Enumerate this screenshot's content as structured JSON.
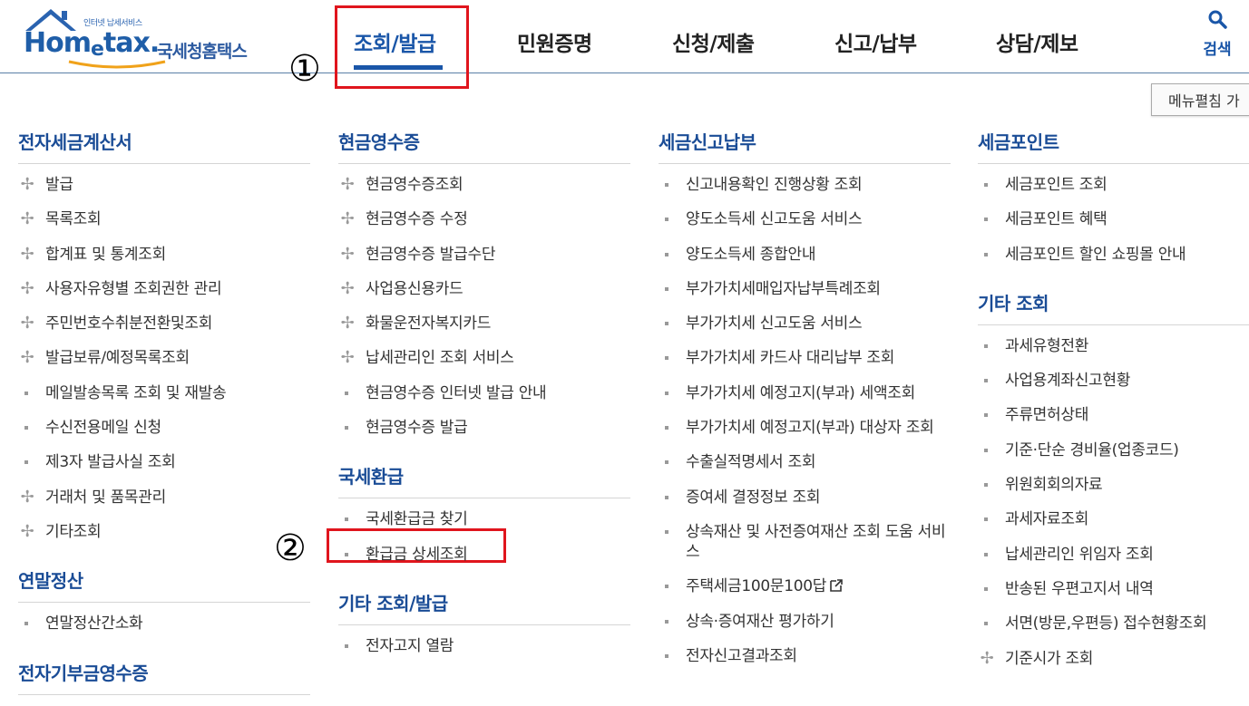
{
  "logo": {
    "tagline": "인터넷 납세서비스",
    "wordmark_1": "Hom",
    "wordmark_2": "e",
    "wordmark_3": "tax.",
    "korean": "국세청홈택스"
  },
  "gnb": [
    {
      "label": "조회/발급",
      "active": true
    },
    {
      "label": "민원증명"
    },
    {
      "label": "신청/제출"
    },
    {
      "label": "신고/납부"
    },
    {
      "label": "상담/제보"
    }
  ],
  "search": {
    "label": "검색",
    "icon": "search-icon"
  },
  "annotations": {
    "marker1": "①",
    "marker2": "②"
  },
  "toggle_button": "메뉴펼침 가",
  "columns": [
    {
      "sections": [
        {
          "title": "전자세금계산서",
          "items": [
            {
              "label": "발급",
              "icon": "plus"
            },
            {
              "label": "목록조회",
              "icon": "plus"
            },
            {
              "label": "합계표 및 통계조회",
              "icon": "plus"
            },
            {
              "label": "사용자유형별 조회권한 관리",
              "icon": "plus"
            },
            {
              "label": "주민번호수취분전환및조회",
              "icon": "plus"
            },
            {
              "label": "발급보류/예정목록조회",
              "icon": "plus"
            },
            {
              "label": "메일발송목록 조회 및 재발송",
              "icon": "bullet"
            },
            {
              "label": "수신전용메일 신청",
              "icon": "bullet"
            },
            {
              "label": "제3자 발급사실 조회",
              "icon": "bullet"
            },
            {
              "label": "거래처 및 품목관리",
              "icon": "plus"
            },
            {
              "label": "기타조회",
              "icon": "plus"
            }
          ]
        },
        {
          "title": "연말정산",
          "items": [
            {
              "label": "연말정산간소화",
              "icon": "bullet"
            }
          ]
        },
        {
          "title": "전자기부금영수증",
          "items": []
        }
      ]
    },
    {
      "sections": [
        {
          "title": "현금영수증",
          "items": [
            {
              "label": "현금영수증조회",
              "icon": "plus"
            },
            {
              "label": "현금영수증 수정",
              "icon": "plus"
            },
            {
              "label": "현금영수증 발급수단",
              "icon": "plus"
            },
            {
              "label": "사업용신용카드",
              "icon": "plus"
            },
            {
              "label": "화물운전자복지카드",
              "icon": "plus"
            },
            {
              "label": "납세관리인 조회 서비스",
              "icon": "plus"
            },
            {
              "label": "현금영수증 인터넷 발급 안내",
              "icon": "bullet"
            },
            {
              "label": "현금영수증 발급",
              "icon": "bullet"
            }
          ]
        },
        {
          "title": "국세환급",
          "items": [
            {
              "label": "국세환급금 찾기",
              "icon": "bullet"
            },
            {
              "label": "환급금 상세조회",
              "icon": "bullet"
            }
          ]
        },
        {
          "title": "기타 조회/발급",
          "items": [
            {
              "label": "전자고지 열람",
              "icon": "bullet"
            }
          ]
        }
      ]
    },
    {
      "sections": [
        {
          "title": "세금신고납부",
          "items": [
            {
              "label": "신고내용확인 진행상황 조회",
              "icon": "bullet"
            },
            {
              "label": "양도소득세 신고도움 서비스",
              "icon": "bullet"
            },
            {
              "label": "양도소득세 종합안내",
              "icon": "bullet"
            },
            {
              "label": "부가가치세매입자납부특례조회",
              "icon": "bullet"
            },
            {
              "label": "부가가치세 신고도움 서비스",
              "icon": "bullet"
            },
            {
              "label": "부가가치세 카드사 대리납부 조회",
              "icon": "bullet"
            },
            {
              "label": "부가가치세 예정고지(부과) 세액조회",
              "icon": "bullet"
            },
            {
              "label": "부가가치세 예정고지(부과) 대상자 조회",
              "icon": "bullet"
            },
            {
              "label": "수출실적명세서 조회",
              "icon": "bullet"
            },
            {
              "label": "증여세 결정정보 조회",
              "icon": "bullet"
            },
            {
              "label": "상속재산 및 사전증여재산 조회 도움 서비스",
              "icon": "bullet"
            },
            {
              "label": "주택세금100문100답",
              "icon": "bullet",
              "external": true
            },
            {
              "label": "상속·증여재산 평가하기",
              "icon": "bullet"
            },
            {
              "label": "전자신고결과조회",
              "icon": "bullet"
            }
          ]
        }
      ]
    },
    {
      "sections": [
        {
          "title": "세금포인트",
          "items": [
            {
              "label": "세금포인트 조회",
              "icon": "bullet"
            },
            {
              "label": "세금포인트 혜택",
              "icon": "bullet"
            },
            {
              "label": "세금포인트 할인 쇼핑몰 안내",
              "icon": "bullet"
            }
          ]
        },
        {
          "title": "기타 조회",
          "items": [
            {
              "label": "과세유형전환",
              "icon": "bullet"
            },
            {
              "label": "사업용계좌신고현황",
              "icon": "bullet"
            },
            {
              "label": "주류면허상태",
              "icon": "bullet"
            },
            {
              "label": "기준·단순 경비율(업종코드)",
              "icon": "bullet"
            },
            {
              "label": "위원회회의자료",
              "icon": "bullet"
            },
            {
              "label": "과세자료조회",
              "icon": "bullet"
            },
            {
              "label": "납세관리인 위임자 조회",
              "icon": "bullet"
            },
            {
              "label": "반송된 우편고지서 내역",
              "icon": "bullet"
            },
            {
              "label": "서면(방문,우편등) 접수현황조회",
              "icon": "bullet"
            },
            {
              "label": "기준시가 조회",
              "icon": "plus"
            }
          ]
        }
      ]
    }
  ],
  "colors": {
    "brand": "#1a56a8",
    "highlight": "#e0151d",
    "section_title": "#1a4c96"
  }
}
